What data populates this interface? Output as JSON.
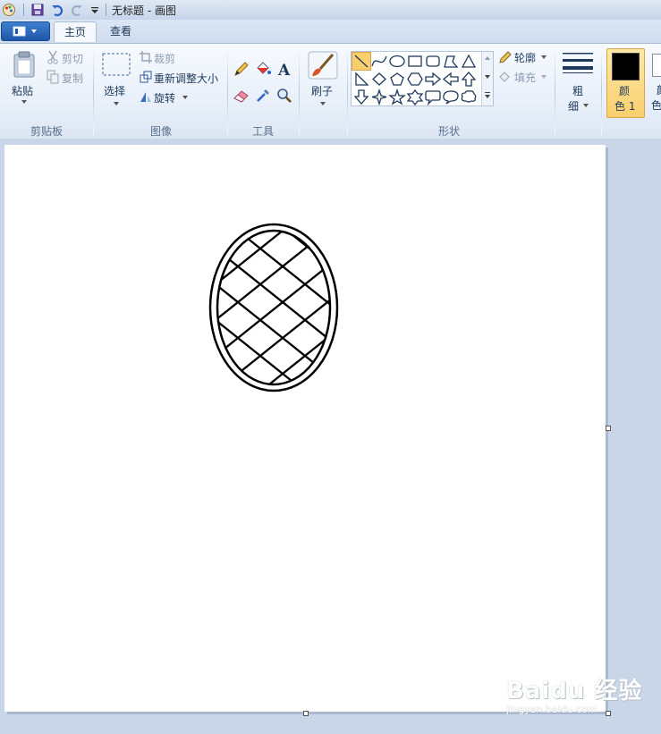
{
  "window": {
    "title": "无标题 - 画图"
  },
  "quick_access": {
    "icons": [
      "paint-app-icon",
      "save-icon",
      "undo-icon",
      "redo-icon",
      "customize-dropdown-icon"
    ]
  },
  "tabs": [
    {
      "label": "主页",
      "active": true
    },
    {
      "label": "查看",
      "active": false
    }
  ],
  "ribbon": {
    "clipboard": {
      "paste": "粘贴",
      "cut": "剪切",
      "copy": "复制",
      "group": "剪贴板"
    },
    "image": {
      "select": "选择",
      "crop": "裁剪",
      "resize": "重新调整大小",
      "rotate": "旋转",
      "group": "图像"
    },
    "tools": {
      "group": "工具",
      "icons": [
        "pencil-icon",
        "fill-icon",
        "text-icon",
        "eraser-icon",
        "color-picker-icon",
        "magnifier-icon"
      ]
    },
    "brushes": {
      "label": "刷子"
    },
    "shapes": {
      "outline": "轮廓",
      "fill": "填充",
      "group": "形状"
    },
    "size": {
      "label_line1": "粗",
      "label_line2": "细"
    },
    "color1": {
      "label_line1": "颜",
      "label_line2": "色 1",
      "value": "#000000"
    },
    "color2": {
      "label_line1": "颜",
      "label_line2": "色"
    }
  },
  "colors": {
    "accent_selected": "#f9cf6d",
    "ribbon_bg": "#e9f0f9",
    "workspace_bg": "#c9d6e8"
  },
  "watermark": {
    "brand": "Baidu 经验",
    "url": "jingyan.baidu.com"
  }
}
